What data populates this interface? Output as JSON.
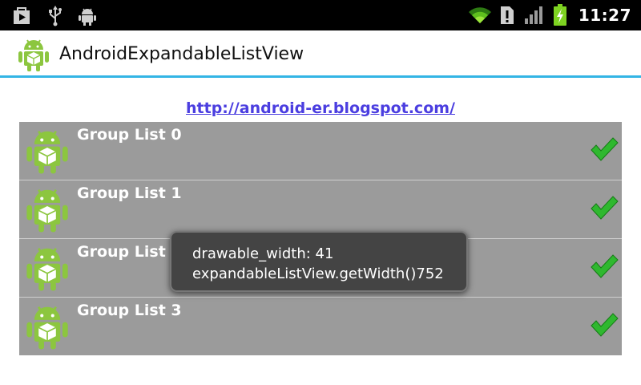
{
  "status_bar": {
    "clock": "11:27",
    "icons_left": [
      "play-store-icon",
      "usb-icon",
      "android-debug-icon"
    ],
    "icons_right": [
      "wifi-icon",
      "alert-icon",
      "signal-icon",
      "battery-charging-icon"
    ]
  },
  "app": {
    "title": "AndroidExpandableListView"
  },
  "content": {
    "link": "http://android-er.blogspot.com/"
  },
  "groups": [
    {
      "label": "Group List 0"
    },
    {
      "label": "Group List 1"
    },
    {
      "label": "Group List 2"
    },
    {
      "label": "Group List 3"
    }
  ],
  "toast": {
    "line1": "drawable_width: 41",
    "line2": "expandableListView.getWidth()752"
  },
  "colors": {
    "accent_divider": "#33b5e5",
    "group_background": "#9b9b9b",
    "link": "#4b3ee0",
    "android_green": "#8cc63f",
    "check_green": "#2fb82f",
    "toast_background": "#444444"
  }
}
